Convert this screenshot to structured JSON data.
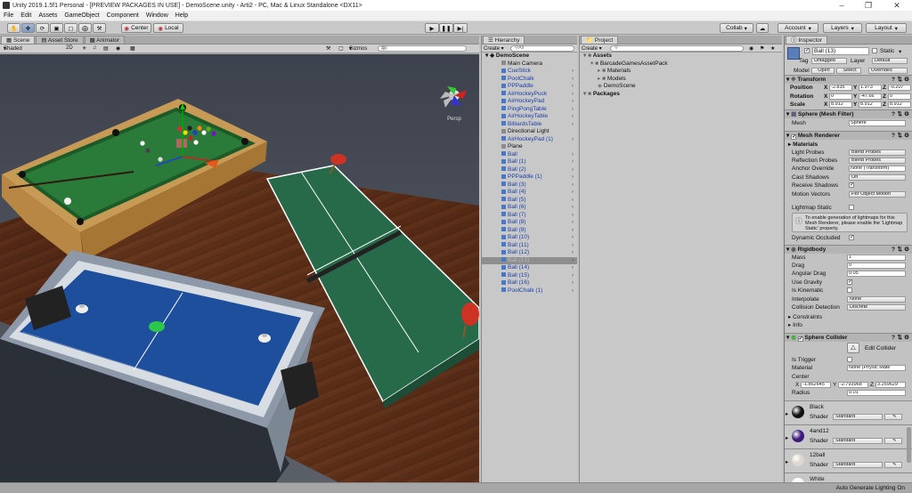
{
  "window": {
    "title": "Unity 2019.1.5f1 Personal - [PREVIEW PACKAGES IN USE] - DemoScene.unity - Arti2 - PC, Mac & Linux Standalone <DX11>"
  },
  "menu": [
    "File",
    "Edit",
    "Assets",
    "GameObject",
    "Component",
    "Window",
    "Help"
  ],
  "toolbar": {
    "pivot": "Center",
    "space": "Local",
    "collab": "Collab",
    "account": "Account",
    "layers": "Layers",
    "layout": "Layout"
  },
  "scene": {
    "tabs": [
      "Scene",
      "Asset Store",
      "Animator"
    ],
    "shading": "Shaded",
    "mode_2d": "2D",
    "gizmos": "Gizmos",
    "search_placeholder": "All",
    "persp": "Persp"
  },
  "hierarchy": {
    "tab": "Hierarchy",
    "create": "Create",
    "search_placeholder": "All",
    "scene_name": "DemoScene",
    "items": [
      {
        "label": "Main Camera",
        "blue": false
      },
      {
        "label": "CueStick",
        "blue": true
      },
      {
        "label": "PoolChalk",
        "blue": true
      },
      {
        "label": "PPPaddle",
        "blue": true
      },
      {
        "label": "AirHockeyPuck",
        "blue": true
      },
      {
        "label": "AirHockeyPad",
        "blue": true
      },
      {
        "label": "PingPongTable",
        "blue": true
      },
      {
        "label": "AirHockeyTable",
        "blue": true
      },
      {
        "label": "BilliardsTable",
        "blue": true
      },
      {
        "label": "Directional Light",
        "blue": false
      },
      {
        "label": "AirHockeyPad (1)",
        "blue": true
      },
      {
        "label": "Plane",
        "blue": false
      },
      {
        "label": "Ball",
        "blue": true
      },
      {
        "label": "Ball (1)",
        "blue": true
      },
      {
        "label": "Ball (2)",
        "blue": true
      },
      {
        "label": "PPPaddle (1)",
        "blue": true
      },
      {
        "label": "Ball (3)",
        "blue": true
      },
      {
        "label": "Ball (4)",
        "blue": true
      },
      {
        "label": "Ball (5)",
        "blue": true
      },
      {
        "label": "Ball (6)",
        "blue": true
      },
      {
        "label": "Ball (7)",
        "blue": true
      },
      {
        "label": "Ball (8)",
        "blue": true
      },
      {
        "label": "Ball (9)",
        "blue": true
      },
      {
        "label": "Ball (10)",
        "blue": true
      },
      {
        "label": "Ball (11)",
        "blue": true
      },
      {
        "label": "Ball (12)",
        "blue": true
      },
      {
        "label": "Ball (13)",
        "blue": true,
        "selected": true
      },
      {
        "label": "Ball (14)",
        "blue": true
      },
      {
        "label": "Ball (15)",
        "blue": true
      },
      {
        "label": "Ball (16)",
        "blue": true
      },
      {
        "label": "PoolChalk (1)",
        "blue": true
      }
    ]
  },
  "project": {
    "tab": "Project",
    "create": "Create",
    "tree": [
      {
        "label": "Assets",
        "bold": true,
        "indent": 0
      },
      {
        "label": "BarcadeGamesAssetPack",
        "bold": false,
        "indent": 1
      },
      {
        "label": "Materials",
        "bold": false,
        "indent": 2
      },
      {
        "label": "Models",
        "bold": false,
        "indent": 2
      },
      {
        "label": "DemoScene",
        "bold": false,
        "indent": 2
      },
      {
        "label": "Packages",
        "bold": true,
        "indent": 0
      }
    ]
  },
  "inspector": {
    "tab": "Inspector",
    "object_name": "Ball (13)",
    "static_label": "Static",
    "tag_label": "Tag",
    "tag_value": "Untagged",
    "layer_label": "Layer",
    "layer_value": "Default",
    "model_label": "Model",
    "model_open": "Open",
    "model_select": "Select",
    "model_overrides": "Overrides",
    "transform": {
      "title": "Transform",
      "position_label": "Position",
      "rotation_label": "Rotation",
      "scale_label": "Scale",
      "position": [
        "-2.835",
        "1.973",
        "-0.207"
      ],
      "rotation": [
        "0",
        "-47.66",
        "0"
      ],
      "scale": [
        "8.912",
        "8.912",
        "8.912"
      ]
    },
    "mesh_filter": {
      "title": "Sphere (Mesh Filter)",
      "mesh_label": "Mesh",
      "mesh_value": "Sphere"
    },
    "mesh_renderer": {
      "title": "Mesh Renderer",
      "materials_label": "Materials",
      "light_probes_label": "Light Probes",
      "light_probes": "Blend Probes",
      "reflection_probes_label": "Reflection Probes",
      "reflection_probes": "Blend Probes",
      "anchor_override_label": "Anchor Override",
      "anchor_override": "None (Transform)",
      "cast_shadows_label": "Cast Shadows",
      "cast_shadows": "On",
      "receive_shadows_label": "Receive Shadows",
      "motion_vectors_label": "Motion Vectors",
      "motion_vectors": "Per Object Motion",
      "lightmap_static_label": "Lightmap Static",
      "info": "To enable generation of lightmaps for this Mesh Renderer, please enable the 'Lightmap Static' property.",
      "dynamic_occluded_label": "Dynamic Occluded"
    },
    "rigidbody": {
      "title": "Rigidbody",
      "mass_label": "Mass",
      "mass": "1",
      "drag_label": "Drag",
      "drag": "0",
      "angular_drag_label": "Angular Drag",
      "angular_drag": "0.05",
      "use_gravity_label": "Use Gravity",
      "is_kinematic_label": "Is Kinematic",
      "interpolate_label": "Interpolate",
      "interpolate": "None",
      "collision_label": "Collision Detection",
      "collision": "Discrete",
      "constraints_label": "Constraints",
      "info_label": "Info"
    },
    "collider": {
      "title": "Sphere Collider",
      "edit_label": "Edit Collider",
      "is_trigger_label": "Is Trigger",
      "material_label": "Material",
      "material": "None (Physic Mate",
      "center_label": "Center",
      "center": [
        "-1.862645",
        "-2.793968",
        "3.259629"
      ],
      "radius_label": "Radius",
      "radius": "0.01"
    },
    "materials": [
      {
        "name": "Black",
        "shader_label": "Shader",
        "shader": "Standard",
        "color": "#111111"
      },
      {
        "name": "4and12",
        "shader_label": "Shader",
        "shader": "Standard",
        "color": "#3b1a7a"
      },
      {
        "name": "12ball",
        "shader_label": "Shader",
        "shader": "Standard",
        "color": "#ddd6cc"
      },
      {
        "name": "White",
        "shader_label": "Shader",
        "shader": "Standard",
        "color": "#ffffff"
      }
    ]
  },
  "status": {
    "text": "Auto Generate Lighting On"
  },
  "colors": {
    "accent": "#1a3fa8",
    "selection": "#8e8e8e"
  }
}
